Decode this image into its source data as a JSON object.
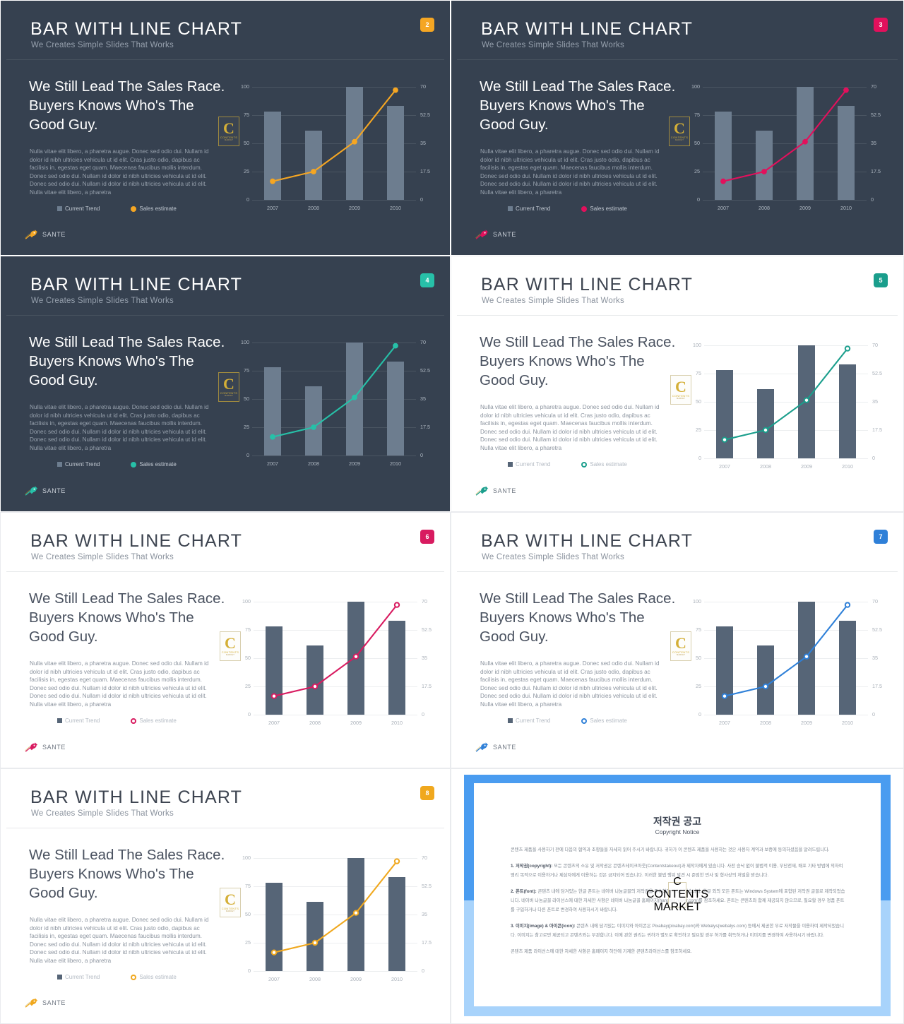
{
  "deck": {
    "title": "BAR WITH LINE CHART",
    "subtitle": "We Creates Simple Slides That Works",
    "headline": "We Still Lead The Sales Race. Buyers Knows Who's The Good Guy.",
    "paragraph": "Nulla vitae elit libero, a pharetra augue. Donec sed odio dui. Nullam id dolor id nibh ultricies vehicula ut id elit. Cras justo odio, dapibus ac facilisis in, egestas eget quam. Maecenas faucibus mollis interdum. Donec sed odio dui. Nullam id dolor id nibh ultricies vehicula ut id elit. Donec sed odio dui. Nullam id dolor id nibh ultricies vehicula ut id elit. Nulla vitae elit libero, a pharetra",
    "brand_name": "SANTE",
    "logo_glyph": "C",
    "logo_word": "CONTENTS",
    "logo_word2": "MARKET"
  },
  "slides": [
    {
      "badge": "2",
      "theme": "dark",
      "accent": "#f5a623"
    },
    {
      "badge": "3",
      "theme": "dark",
      "accent": "#e2105c"
    },
    {
      "badge": "4",
      "theme": "dark",
      "accent": "#27c0a8"
    },
    {
      "badge": "5",
      "theme": "light",
      "accent": "#1a9e8c"
    },
    {
      "badge": "6",
      "theme": "light",
      "accent": "#d81b60"
    },
    {
      "badge": "7",
      "theme": "light",
      "accent": "#2f80d8"
    },
    {
      "badge": "8",
      "theme": "light",
      "accent": "#f0a81e"
    }
  ],
  "chart_data": {
    "type": "bar",
    "title": "",
    "categories": [
      "2007",
      "2008",
      "2009",
      "2010"
    ],
    "series": [
      {
        "name": "Current Trend",
        "type": "bar",
        "axis": "left",
        "values": [
          78,
          61,
          100,
          83
        ]
      },
      {
        "name": "Sales estimate",
        "type": "line",
        "axis": "right",
        "values": [
          11.5,
          17.5,
          36,
          68
        ]
      }
    ],
    "left_axis": {
      "label": "",
      "ticks": [
        "0",
        "25",
        "50",
        "75",
        "100"
      ],
      "min": 0,
      "max": 100
    },
    "right_axis": {
      "label": "",
      "ticks": [
        "0",
        "17.5",
        "35",
        "52.5",
        "70"
      ],
      "min": 0,
      "max": 70
    },
    "xlabel": "",
    "ylabel": "",
    "grid": true,
    "legend_position": "bottom-left"
  },
  "copyright": {
    "title_ko": "저작권 공고",
    "title_en": "Copyright Notice",
    "p0": "콘텐츠 제품을 사용하기 전에 다음의 협약과 조항들을 자세히 읽어 주시기 바랍니다. 귀하가 이 콘텐츠 제품을 사용하는 것은 사용자 계약과 보증에 동의하셨음을 알려드립니다.",
    "p1_label": "1. 저작권(copyright):",
    "p1": "모든 콘텐츠의 소유 및 저작권은 콘텐츠테이크아웃(Contentstakeout)과 제작자에게 있습니다. 사전 승낙 없이 불법적 이용, 무단전재, 배포 기타 방법에 의하여 영리 목적으로 이용하거나 제삼자에게 이용하는 것은 금지되어 있습니다. 이러한 불법 행위 발견 시 준엄한 민사 및 형사상의 처벌을 받습니다.",
    "p2_label": "2. 폰트(font):",
    "p2": "콘텐츠 내에 담겨있는 한글 폰트는 네이버 나눔글꼴의 저작권을 준수하여 제작되었습니다. 한글 외의 모든 폰트는 Windows System에 포함된 저작권 글꼴로 제작되었습니다. 네이버 나눔글꼴 라이선스에 대한 자세한 사항은 네이버 나눔글꼴 홈페이지(hangeul.naver.com)를 참조하세요. 폰트는 콘텐츠와 함께 제공되지 않으므로, 필요할 경우 정품 폰트를 구입하거나 다른 폰트로 변경하여 사용하시기 바랍니다.",
    "p3_label": "3. 이미지(image) & 아이콘(icon):",
    "p3": "콘텐츠 내에 담겨있는 이미지와 아이콘은 Pixabay(pixabay.com)와 Webalys(webalys.com) 등에서 제공한 무료 저작물을 이용하여 제작되었습니다. 이미지는 참고로만 제공되고 콘텐츠와는 무관합니다. 이에 관한 권리는 귀하가 별도로 확인하고 필요할 경우 허가를 취득하거나 이미지를 변경하여 사용하시기 바랍니다.",
    "p4": "콘텐츠 제품 라이선스에 대한 자세한 사항은 홈페이지 하단에 기재한 콘텐츠라이선스를 참조하세요."
  }
}
